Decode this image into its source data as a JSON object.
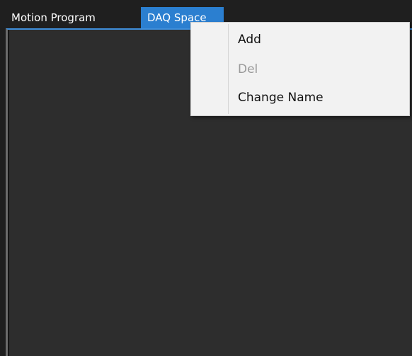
{
  "tabs": [
    {
      "label": "Motion Program",
      "active": false
    },
    {
      "label": "DAQ Space",
      "active": true
    }
  ],
  "context_menu": {
    "items": [
      {
        "label": "Add",
        "enabled": true
      },
      {
        "label": "Del",
        "enabled": false
      },
      {
        "label": "Change Name",
        "enabled": true
      }
    ]
  },
  "colors": {
    "active_tab": "#2b7fd0",
    "panel_background": "#2d2d2d",
    "menu_background": "#f2f2f2",
    "disabled_text": "#9a9a9a"
  }
}
